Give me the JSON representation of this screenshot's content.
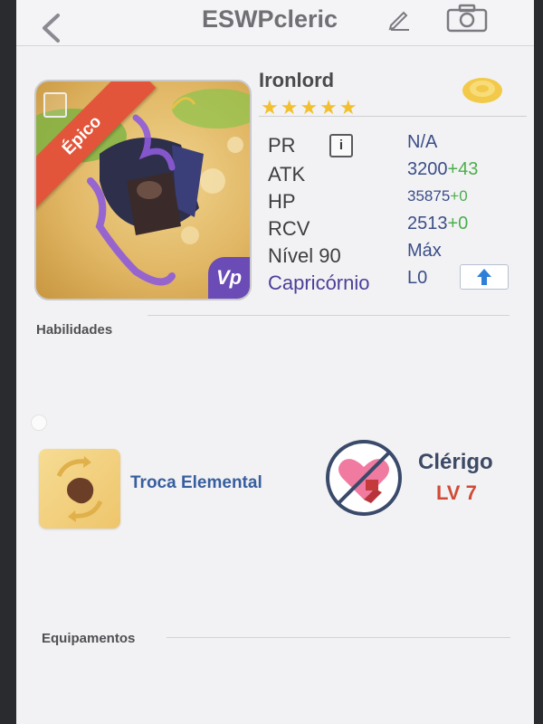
{
  "header": {
    "title": "ESWPcleric",
    "back_icon": "chevron-left-icon",
    "edit_icon": "pencil-icon",
    "camera_icon": "camera-icon"
  },
  "hero": {
    "name": "Ironlord",
    "rarity": "Épico",
    "stars": "★★★★★",
    "tag_letter": "E",
    "badge": "Vp"
  },
  "stats": {
    "pr_label": "PR",
    "pr_value": "N/A",
    "info_label": "i",
    "atk_label": "ATK",
    "atk_value": "3200",
    "atk_bonus": "+43",
    "hp_label": "HP",
    "hp_value": "35875",
    "hp_bonus": "+0",
    "rcv_label": "RCV",
    "rcv_value": "2513",
    "rcv_bonus": "+0",
    "level_label": "Nível 90",
    "level_value": "Máx",
    "sign_label": "Capricórnio",
    "sign_value": "L0"
  },
  "sections": {
    "skills": "Habilidades",
    "equipment": "Equipamentos"
  },
  "skill": {
    "name": "Troca Elemental"
  },
  "hero_class": {
    "name": "Clérigo",
    "level": "LV 7"
  },
  "colors": {
    "accent_blue": "#3a4d88",
    "bonus_green": "#4cae4c",
    "rarity_red": "#e2553a",
    "level_red": "#d04a36",
    "star_gold": "#f2c02e"
  }
}
